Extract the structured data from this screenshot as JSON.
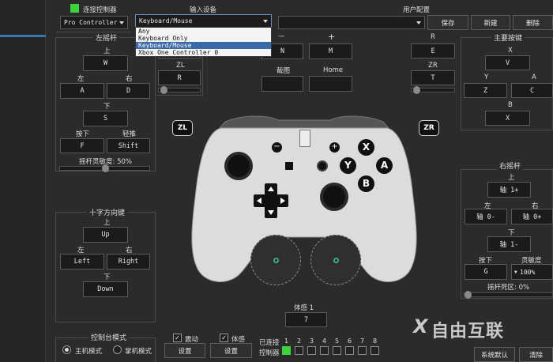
{
  "header": {
    "connect_label": "连接控制器",
    "connect_status_color": "#3ed23e",
    "controller_type": "Pro Controller",
    "input_device_label": "输入设备",
    "input_device_value": "Keyboard/Mouse",
    "input_device_options": [
      "Any",
      "Keyboard Only",
      "Keyboard/Mouse",
      "Xbox One Controller 0"
    ],
    "profile_label": "用户配置",
    "profile_value": "",
    "save_label": "保存",
    "new_label": "新建",
    "delete_label": "删除"
  },
  "left_stick": {
    "title": "左摇杆",
    "up_label": "上",
    "up_key": "W",
    "left_label": "左",
    "left_key": "A",
    "right_label": "右",
    "right_key": "D",
    "down_label": "下",
    "down_key": "S",
    "press_label": "按下",
    "press_key": "F",
    "light_label": "轻推",
    "light_key": "Shift",
    "sensitivity_label": "摇杆灵敏度: 50%",
    "sensitivity_value": 0.5
  },
  "triggers_left": {
    "zl_label": "ZL",
    "zl_key": "R",
    "l_key": ""
  },
  "center": {
    "minus_label": "—",
    "minus_key": "N",
    "plus_label": "+",
    "plus_key": "M",
    "capture_label": "截图",
    "capture_key": "",
    "home_label": "Home",
    "home_key": ""
  },
  "triggers_right": {
    "r_label": "R",
    "r_key": "E",
    "zr_label": "ZR",
    "zr_key": "T"
  },
  "main_buttons": {
    "title": "主要按键",
    "x_label": "X",
    "x_key": "V",
    "y_label": "Y",
    "y_key": "Z",
    "a_label": "A",
    "a_key": "C",
    "b_label": "B",
    "b_key": "X"
  },
  "controller": {
    "zl_badge": "ZL",
    "zr_badge": "ZR",
    "btn_x": "X",
    "btn_y": "Y",
    "btn_a": "A",
    "btn_b": "B",
    "minus": "−",
    "plus": "+"
  },
  "dpad": {
    "title": "十字方向键",
    "up_label": "上",
    "up_key": "Up",
    "left_label": "左",
    "left_key": "Left",
    "right_label": "右",
    "right_key": "Right",
    "down_label": "下",
    "down_key": "Down"
  },
  "right_stick": {
    "title": "右摇杆",
    "up_label": "上",
    "up_key": "轴 1+",
    "left_label": "左",
    "left_key": "轴 0-",
    "right_label": "右",
    "right_key": "轴 0+",
    "down_label": "下",
    "down_key": "轴 1-",
    "press_label": "按下",
    "press_key": "G",
    "sensitivity_label": "灵敏度",
    "sensitivity_value": "100%",
    "deadzone_label": "摇杆死区: 0%",
    "deadzone_value": 0
  },
  "motion": {
    "title": "体感 1",
    "value": "7"
  },
  "console_mode": {
    "title": "控制台模式",
    "docked_label": "主机模式",
    "handheld_label": "掌机模式",
    "selected": "docked"
  },
  "rumble": {
    "label": "震动",
    "checked": true,
    "settings_label": "设置"
  },
  "motion_opt": {
    "label": "体感",
    "checked": true,
    "settings_label": "设置"
  },
  "connected": {
    "label_line1": "已连接",
    "label_line2": "控制器",
    "slots": [
      "1",
      "2",
      "3",
      "4",
      "5",
      "6",
      "7",
      "8"
    ],
    "active_slot": 1
  },
  "footer": {
    "defaults_label": "系统默认",
    "clear_label": "清除"
  },
  "watermark": {
    "text": "自由互联"
  }
}
